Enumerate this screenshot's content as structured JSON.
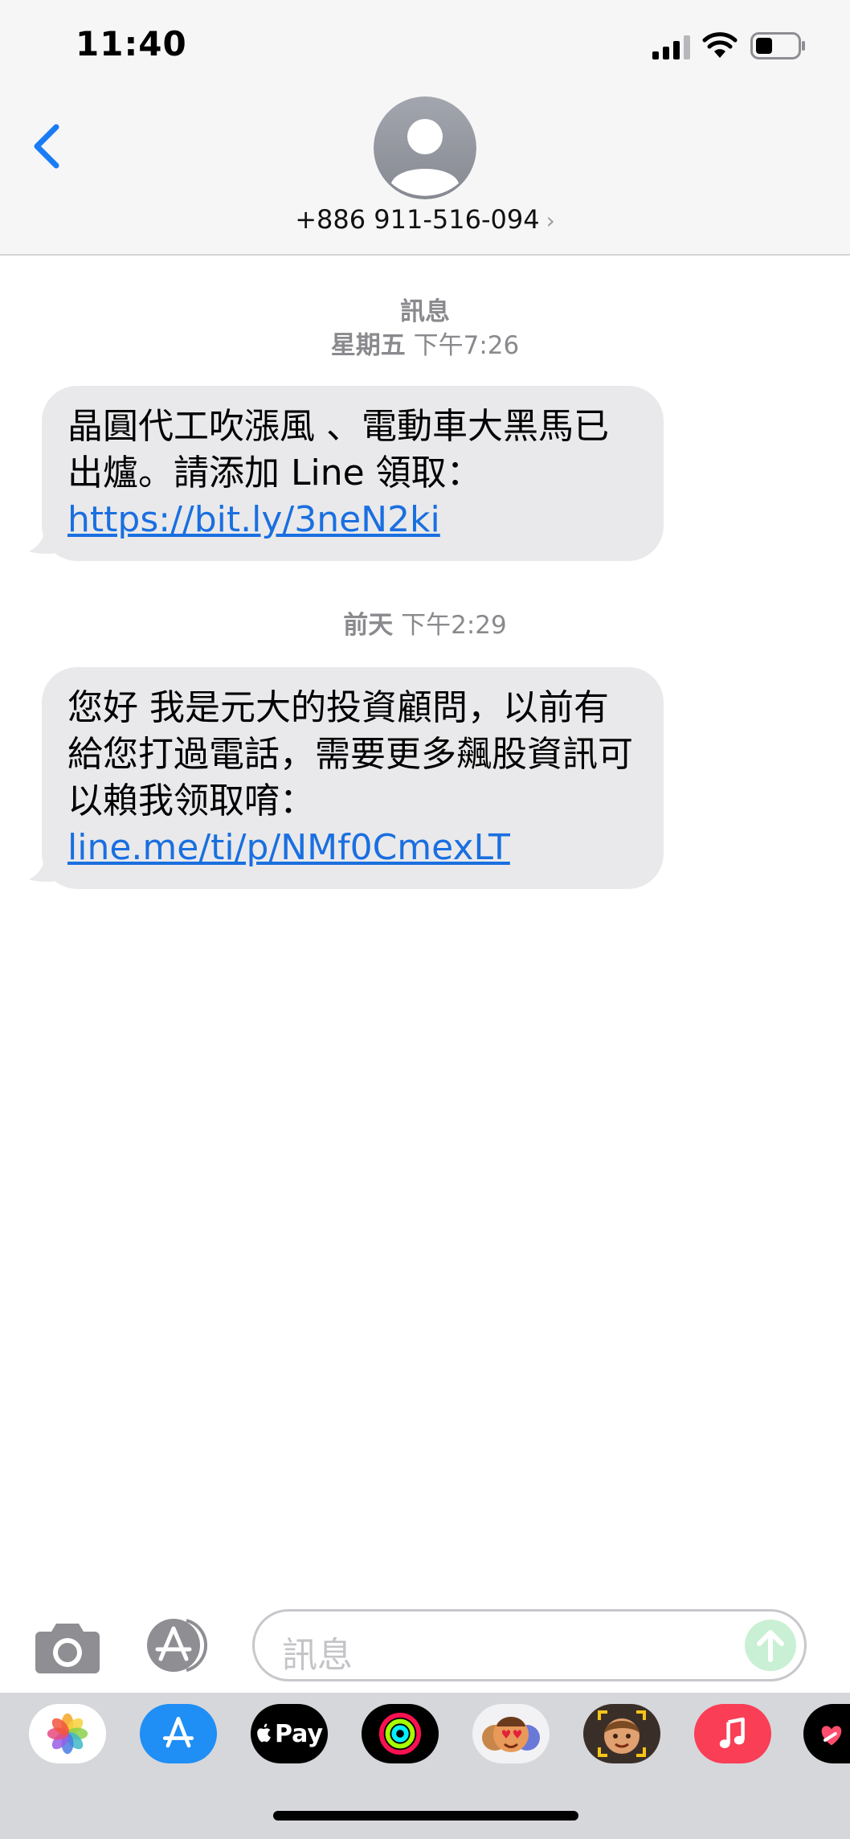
{
  "status_bar": {
    "time": "11:40"
  },
  "header": {
    "contact": "+886 911-516-094",
    "chevron": "›"
  },
  "conversation": {
    "label": "訊息",
    "groups": [
      {
        "stamp_day": "星期五",
        "stamp_time": "下午7:26",
        "message_text": "晶圓代工吹漲風 、電動車大黑馬已出爐。請添加 Line 領取：",
        "message_link": "https://bit.ly/3neN2ki"
      },
      {
        "stamp_day": "前天",
        "stamp_time": "下午2:29",
        "message_text": "您好 我是元大的投資顧問，以前有給您打過電話，需要更多飆股資訊可以賴我领取唷：",
        "message_link": "line.me/ti/p/NMf0CmexLT"
      }
    ]
  },
  "composer": {
    "placeholder": "訊息"
  },
  "app_drawer": {
    "apple_pay_label": "Pay",
    "icons": [
      "photos-icon",
      "app-store-icon",
      "apple-pay-icon",
      "fitness-icon",
      "memoji-stickers-icon",
      "memoji-icon",
      "music-icon",
      "digital-touch-icon"
    ]
  },
  "colors": {
    "link": "#1a6fe0",
    "back": "#1a7cf5",
    "bubble": "#e9e9eb",
    "send_disabled": "#c9f0d4"
  }
}
